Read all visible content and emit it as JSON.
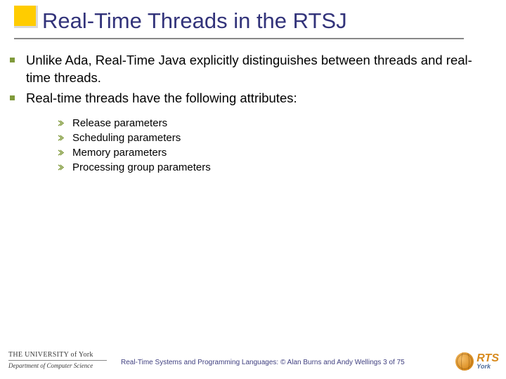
{
  "title": "Real-Time Threads in the RTSJ",
  "bullets": [
    "Unlike Ada, Real-Time Java explicitly distinguishes between threads and real-time threads.",
    "Real-time threads have the following attributes:"
  ],
  "sub_bullets": [
    "Release parameters",
    "Scheduling parameters",
    "Memory parameters",
    "Processing group parameters"
  ],
  "footer": {
    "uni_name": "THE UNIVERSITY of York",
    "uni_dept": "Department of Computer Science",
    "credit": "Real-Time Systems and Programming Languages: © Alan Burns and Andy Wellings",
    "page": "3 of 75",
    "rts_big": "RTS",
    "rts_small": "York"
  }
}
